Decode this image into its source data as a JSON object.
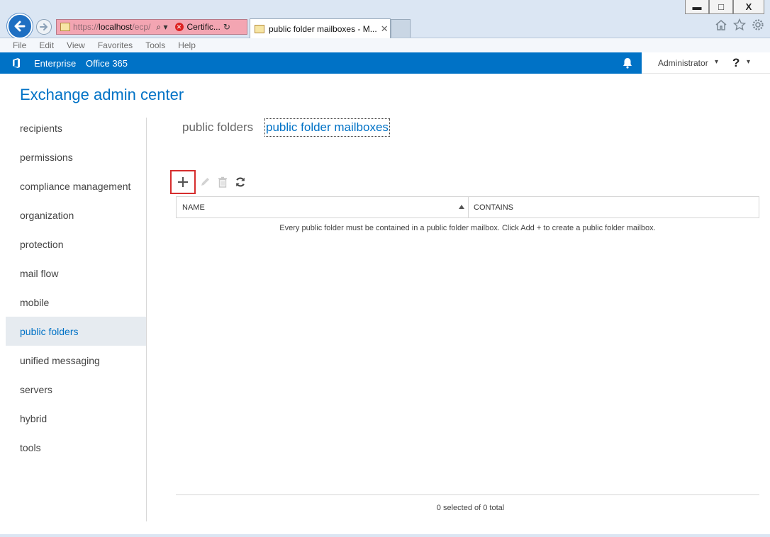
{
  "window": {
    "controls": {
      "minimize": "▬",
      "maximize": "□",
      "close": "X"
    }
  },
  "browser": {
    "address": {
      "prefix": "https://",
      "host": "localhost",
      "path": "/ecp/",
      "search_glyph": "⌕ ▾",
      "cert_label": "Certific...",
      "refresh_glyph": "↻"
    },
    "tab": {
      "title": "public folder mailboxes - M...",
      "close_glyph": "✕"
    },
    "menu": [
      "File",
      "Edit",
      "View",
      "Favorites",
      "Tools",
      "Help"
    ]
  },
  "o365": {
    "links": [
      "Enterprise",
      "Office 365"
    ],
    "user": "Administrator",
    "help": "?",
    "caret": "▾"
  },
  "app": {
    "title": "Exchange admin center"
  },
  "nav": {
    "items": [
      "recipients",
      "permissions",
      "compliance management",
      "organization",
      "protection",
      "mail flow",
      "mobile",
      "public folders",
      "unified messaging",
      "servers",
      "hybrid",
      "tools"
    ],
    "active_index": 7
  },
  "subtabs": {
    "inactive": "public folders",
    "active": "public folder mailboxes"
  },
  "grid": {
    "columns": [
      "NAME",
      "CONTAINS"
    ],
    "empty_message": "Every public folder must be contained in a public folder mailbox. Click Add + to create a public folder mailbox.",
    "status": "0 selected of 0 total"
  },
  "colors": {
    "accent": "#0072c6",
    "highlight_border": "#d62d2d",
    "nav_active_bg": "#e6ebf0"
  }
}
